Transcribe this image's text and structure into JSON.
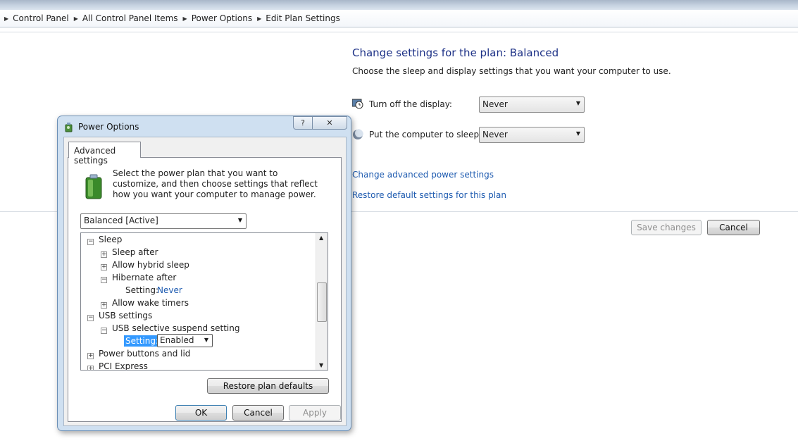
{
  "breadcrumb": [
    "Control Panel",
    "All Control Panel Items",
    "Power Options",
    "Edit Plan Settings"
  ],
  "main": {
    "title": "Change settings for the plan: Balanced",
    "subtitle": "Choose the sleep and display settings that you want your computer to use.",
    "display_label": "Turn off the display:",
    "display_value": "Never",
    "sleep_label": "Put the computer to sleep:",
    "sleep_value": "Never",
    "advanced_link": "Change advanced power settings",
    "restore_link": "Restore default settings for this plan",
    "save_button": "Save changes",
    "cancel_button": "Cancel"
  },
  "dialog": {
    "title": "Power Options",
    "help_glyph": "?",
    "close_glyph": "✕",
    "tab": "Advanced settings",
    "description": "Select the power plan that you want to customize, and then choose settings that reflect how you want your computer to manage power.",
    "plan_value": "Balanced [Active]",
    "tree": {
      "sleep": "Sleep",
      "sleep_after": "Sleep after",
      "hybrid": "Allow hybrid sleep",
      "hibernate": "Hibernate after",
      "setting_label": "Setting:",
      "hibernate_value": "Never",
      "wake_timers": "Allow wake timers",
      "usb": "USB settings",
      "usb_suspend": "USB selective suspend setting",
      "usb_setting_label": "Setting:",
      "usb_value": "Enabled",
      "power_buttons": "Power buttons and lid",
      "pci": "PCI Express"
    },
    "restore_button": "Restore plan defaults",
    "ok": "OK",
    "cancel": "Cancel",
    "apply": "Apply"
  },
  "colors": {
    "title_blue": "#1e3287",
    "link_blue": "#1e5bb0",
    "selection": "#3399ff"
  }
}
